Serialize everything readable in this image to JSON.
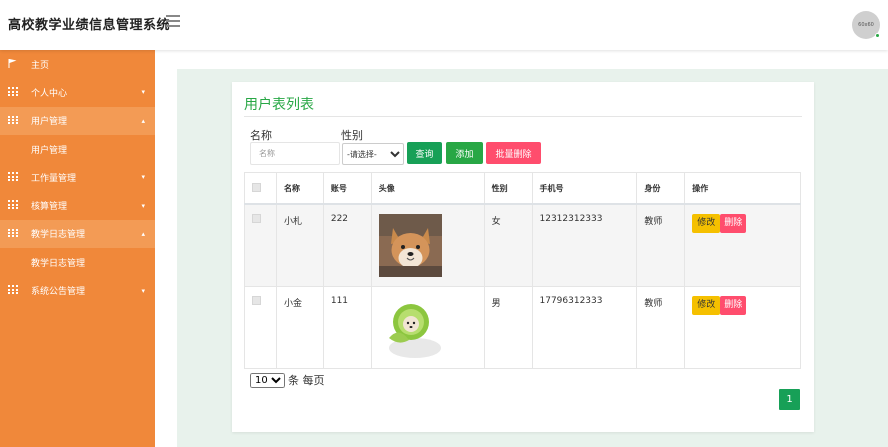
{
  "header": {
    "title": "高校教学业绩信息管理系统",
    "avatar_text": "60x60"
  },
  "sidebar": {
    "items": [
      {
        "label": "主页",
        "icon": "flag-icon",
        "active": false,
        "caret": ""
      },
      {
        "label": "个人中心",
        "icon": "grid-icon",
        "active": false,
        "caret": "▾"
      },
      {
        "label": "用户管理",
        "icon": "grid-icon",
        "active": true,
        "caret": "▴"
      },
      {
        "label": "用户管理",
        "sub": true
      },
      {
        "label": "工作量管理",
        "icon": "grid-icon",
        "active": false,
        "caret": "▾"
      },
      {
        "label": "核算管理",
        "icon": "grid-icon",
        "active": false,
        "caret": "▾"
      },
      {
        "label": "教学日志管理",
        "icon": "grid-icon",
        "active": true,
        "caret": "▴"
      },
      {
        "label": "教学日志管理",
        "sub": true
      },
      {
        "label": "系统公告管理",
        "icon": "grid-icon",
        "active": false,
        "caret": "▾"
      }
    ]
  },
  "panel": {
    "title": "用户表列表"
  },
  "search": {
    "name_label": "名称",
    "name_placeholder": "名称",
    "gender_label": "性别",
    "gender_selected": "-请选择-",
    "query_button": "查询",
    "add_button": "添加",
    "batch_delete_button": "批量删除"
  },
  "table": {
    "headers": [
      "名称",
      "账号",
      "头像",
      "性别",
      "手机号",
      "身份",
      "操作"
    ],
    "rows": [
      {
        "name": "小札",
        "account": "222",
        "gender": "女",
        "phone": "12312312333",
        "role": "教师",
        "edit": "修改",
        "delete": "删除",
        "photo": "shiba-dog-photo"
      },
      {
        "name": "小金",
        "account": "111",
        "gender": "男",
        "phone": "17796312333",
        "role": "教师",
        "edit": "修改",
        "delete": "删除",
        "photo": "cabbage-dog-photo"
      }
    ]
  },
  "pagination": {
    "page_size": "10",
    "page_size_suffix": "条 每页",
    "current_page": "1"
  },
  "colors": {
    "sidebar": "#f0883a",
    "sidebar_active": "#f39b55",
    "accent_green": "#28a745",
    "danger": "#ff4d6d",
    "warning": "#f5c000"
  }
}
